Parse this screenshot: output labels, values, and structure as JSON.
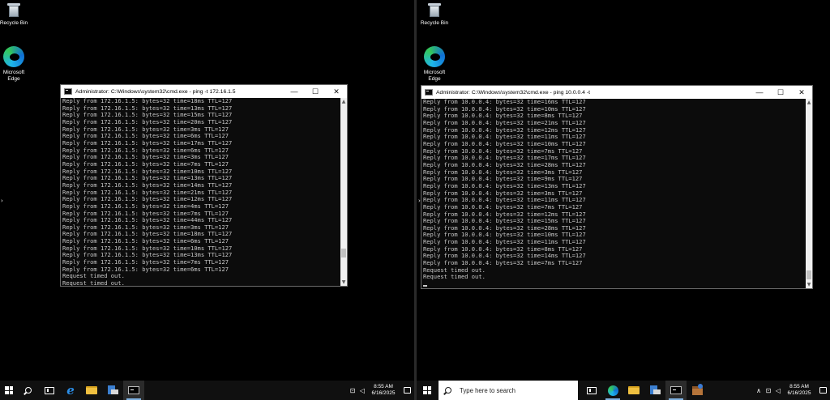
{
  "desktop": {
    "recycle_label": "Recycle Bin",
    "edge_label_line1": "Microsoft",
    "edge_label_line2": "Edge"
  },
  "left_window": {
    "title": "Administrator: C:\\Windows\\system32\\cmd.exe - ping  -t 172.16.1.5",
    "lines": [
      "Reply from 172.16.1.5: bytes=32 time=18ms TTL=127",
      "Reply from 172.16.1.5: bytes=32 time=13ms TTL=127",
      "Reply from 172.16.1.5: bytes=32 time=15ms TTL=127",
      "Reply from 172.16.1.5: bytes=32 time=20ms TTL=127",
      "Reply from 172.16.1.5: bytes=32 time=3ms TTL=127",
      "Reply from 172.16.1.5: bytes=32 time=6ms TTL=127",
      "Reply from 172.16.1.5: bytes=32 time=17ms TTL=127",
      "Reply from 172.16.1.5: bytes=32 time=6ms TTL=127",
      "Reply from 172.16.1.5: bytes=32 time=3ms TTL=127",
      "Reply from 172.16.1.5: bytes=32 time=7ms TTL=127",
      "Reply from 172.16.1.5: bytes=32 time=10ms TTL=127",
      "Reply from 172.16.1.5: bytes=32 time=13ms TTL=127",
      "Reply from 172.16.1.5: bytes=32 time=14ms TTL=127",
      "Reply from 172.16.1.5: bytes=32 time=21ms TTL=127",
      "Reply from 172.16.1.5: bytes=32 time=12ms TTL=127",
      "Reply from 172.16.1.5: bytes=32 time=4ms TTL=127",
      "Reply from 172.16.1.5: bytes=32 time=7ms TTL=127",
      "Reply from 172.16.1.5: bytes=32 time=44ms TTL=127",
      "Reply from 172.16.1.5: bytes=32 time=3ms TTL=127",
      "Reply from 172.16.1.5: bytes=32 time=18ms TTL=127",
      "Reply from 172.16.1.5: bytes=32 time=6ms TTL=127",
      "Reply from 172.16.1.5: bytes=32 time=10ms TTL=127",
      "Reply from 172.16.1.5: bytes=32 time=13ms TTL=127",
      "Reply from 172.16.1.5: bytes=32 time=7ms TTL=127",
      "Reply from 172.16.1.5: bytes=32 time=6ms TTL=127",
      "Request timed out.",
      "Request timed out."
    ]
  },
  "right_window": {
    "title": "Administrator: C:\\Windows\\system32\\cmd.exe - ping  10.0.0.4 -t",
    "lines": [
      "Reply from 10.0.0.4: bytes=32 time=16ms TTL=127",
      "Reply from 10.0.0.4: bytes=32 time=10ms TTL=127",
      "Reply from 10.0.0.4: bytes=32 time=8ms TTL=127",
      "Reply from 10.0.0.4: bytes=32 time=21ms TTL=127",
      "Reply from 10.0.0.4: bytes=32 time=12ms TTL=127",
      "Reply from 10.0.0.4: bytes=32 time=11ms TTL=127",
      "Reply from 10.0.0.4: bytes=32 time=10ms TTL=127",
      "Reply from 10.0.0.4: bytes=32 time=7ms TTL=127",
      "Reply from 10.0.0.4: bytes=32 time=17ms TTL=127",
      "Reply from 10.0.0.4: bytes=32 time=28ms TTL=127",
      "Reply from 10.0.0.4: bytes=32 time=3ms TTL=127",
      "Reply from 10.0.0.4: bytes=32 time=9ms TTL=127",
      "Reply from 10.0.0.4: bytes=32 time=13ms TTL=127",
      "Reply from 10.0.0.4: bytes=32 time=3ms TTL=127",
      "Reply from 10.0.0.4: bytes=32 time=11ms TTL=127",
      "Reply from 10.0.0.4: bytes=32 time=7ms TTL=127",
      "Reply from 10.0.0.4: bytes=32 time=12ms TTL=127",
      "Reply from 10.0.0.4: bytes=32 time=15ms TTL=127",
      "Reply from 10.0.0.4: bytes=32 time=28ms TTL=127",
      "Reply from 10.0.0.4: bytes=32 time=10ms TTL=127",
      "Reply from 10.0.0.4: bytes=32 time=11ms TTL=127",
      "Reply from 10.0.0.4: bytes=32 time=8ms TTL=127",
      "Reply from 10.0.0.4: bytes=32 time=14ms TTL=127",
      "Reply from 10.0.0.4: bytes=32 time=7ms TTL=127",
      "Request timed out.",
      "Request timed out."
    ]
  },
  "window_controls": {
    "minimize": "—",
    "maximize": "☐",
    "close": "✕"
  },
  "scroll": {
    "up": "▲",
    "down": "▼"
  },
  "taskbar": {
    "search_placeholder": "Type here to search",
    "time": "8:55 AM",
    "date": "6/16/2025",
    "tray_chevron": "∧",
    "network_glyph": "⊡",
    "volume_glyph": "◁"
  },
  "side_arrows": {
    "left": "›",
    "right": "›"
  }
}
